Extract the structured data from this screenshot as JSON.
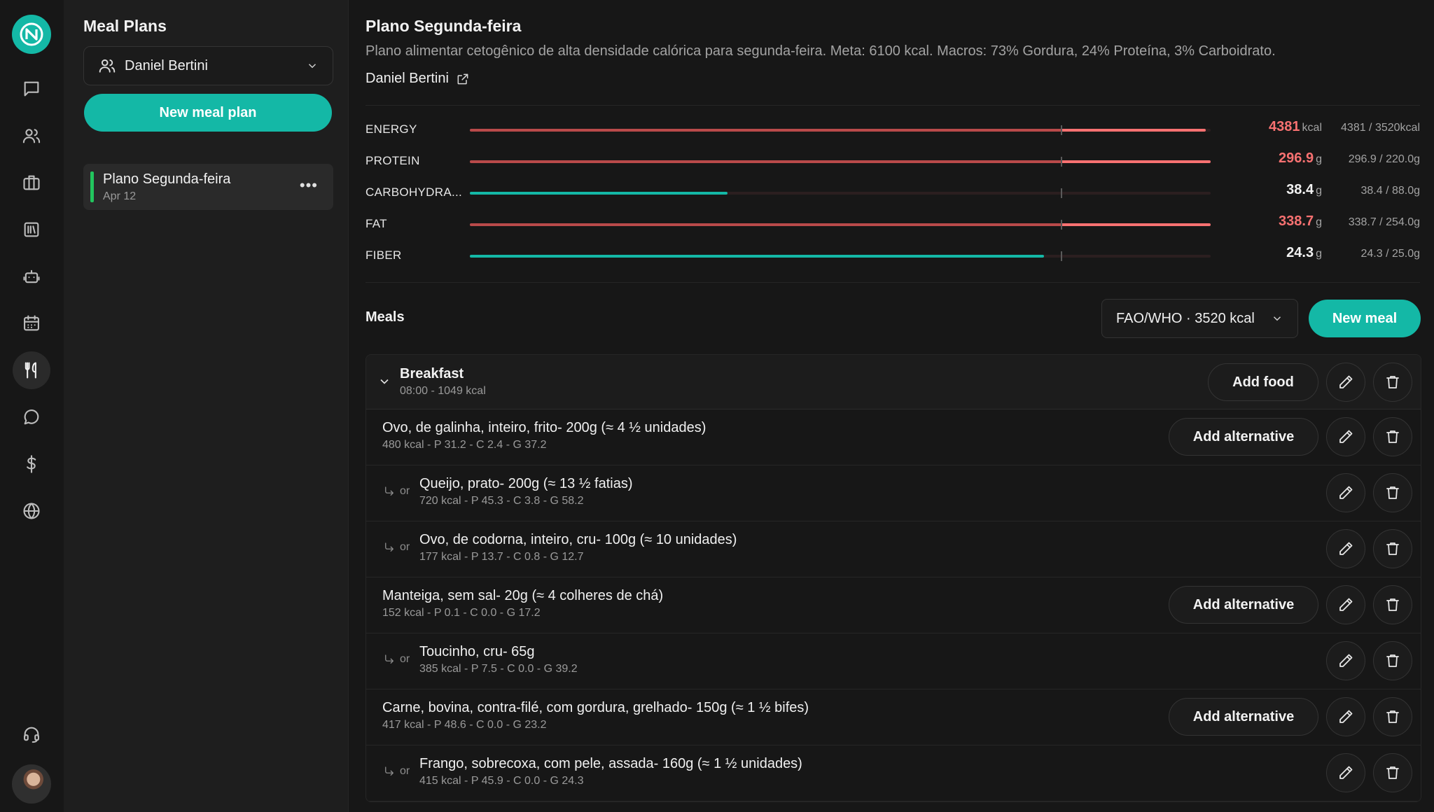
{
  "colors": {
    "accent": "#14b8a6",
    "over": "#f87171",
    "over_dim": "#b94a4a",
    "under": "#14b8a6",
    "active_plan": "#22c55e"
  },
  "rail": {
    "icons": [
      "chat-icon",
      "users-icon",
      "briefcase-icon",
      "library-icon",
      "robot-icon",
      "calendar-icon",
      "utensils-icon",
      "message-circle-icon",
      "dollar-icon",
      "globe-icon",
      "headset-icon"
    ],
    "active": "utensils-icon"
  },
  "sidebar": {
    "title": "Meal Plans",
    "patient_select": "Daniel Bertini",
    "new_plan_label": "New meal plan",
    "plans": [
      {
        "name": "Plano Segunda-feira",
        "date": "Apr 12"
      }
    ]
  },
  "plan": {
    "title": "Plano Segunda-feira",
    "description": "Plano alimentar cetogênico de alta densidade calórica para segunda-feira. Meta: 6100 kcal. Macros: 73% Gordura, 24% Proteína, 3% Carboidrato.",
    "owner": "Daniel Bertini"
  },
  "nutrients": [
    {
      "label": "ENERGY",
      "value": "4381",
      "unit": "kcal",
      "target": "4381 / 3520kcal",
      "ratio": 1.245,
      "over": true
    },
    {
      "label": "PROTEIN",
      "value": "296.9",
      "unit": "g",
      "target": "296.9 / 220.0g",
      "ratio": 1.35,
      "over": true
    },
    {
      "label": "CARBOHYDRA...",
      "value": "38.4",
      "unit": "g",
      "target": "38.4 / 88.0g",
      "ratio": 0.436,
      "over": false
    },
    {
      "label": "FAT",
      "value": "338.7",
      "unit": "g",
      "target": "338.7 / 254.0g",
      "ratio": 1.333,
      "over": true
    },
    {
      "label": "FIBER",
      "value": "24.3",
      "unit": "g",
      "target": "24.3 / 25.0g",
      "ratio": 0.972,
      "over": false
    }
  ],
  "meals_section": {
    "title": "Meals",
    "reference_select": "FAO/WHO · 3520 kcal",
    "new_meal_label": "New meal"
  },
  "meal": {
    "name": "Breakfast",
    "meta": "08:00 - 1049 kcal",
    "add_food_label": "Add food",
    "add_alternative_label": "Add alternative",
    "or_label": "or",
    "foods": [
      {
        "name": "Ovo, de galinha, inteiro, frito- 200g (≈ 4 ½ unidades)",
        "meta": "480 kcal - P 31.2 - C 2.4 - G 37.2",
        "alt": false
      },
      {
        "name": "Queijo, prato- 200g (≈ 13 ½ fatias)",
        "meta": "720 kcal - P 45.3 - C 3.8 - G 58.2",
        "alt": true
      },
      {
        "name": "Ovo, de codorna, inteiro, cru- 100g (≈ 10 unidades)",
        "meta": "177 kcal - P 13.7 - C 0.8 - G 12.7",
        "alt": true
      },
      {
        "name": "Manteiga, sem sal- 20g (≈ 4 colheres de chá)",
        "meta": "152 kcal - P 0.1 - C 0.0 - G 17.2",
        "alt": false
      },
      {
        "name": "Toucinho, cru- 65g",
        "meta": "385 kcal - P 7.5 - C 0.0 - G 39.2",
        "alt": true
      },
      {
        "name": "Carne, bovina, contra-filé, com gordura, grelhado- 150g (≈ 1 ½ bifes)",
        "meta": "417 kcal - P 48.6 - C 0.0 - G 23.2",
        "alt": false
      },
      {
        "name": "Frango, sobrecoxa, com pele, assada- 160g (≈ 1 ½ unidades)",
        "meta": "415 kcal - P 45.9 - C 0.0 - G 24.3",
        "alt": true
      }
    ]
  }
}
